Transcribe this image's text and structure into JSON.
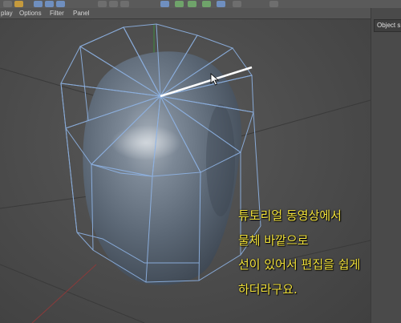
{
  "menubar": {
    "items": [
      "play",
      "Options",
      "Filter",
      "Panel"
    ]
  },
  "right_panel": {
    "tab_label": "Object s"
  },
  "subtitle": {
    "lines": [
      "튜토리얼 동영상에서",
      "물체 바깥으로",
      "선이 있어서 편집을 쉽게",
      "하더라구요."
    ]
  },
  "colors": {
    "wireframe": "#8fb4e6",
    "subtitle_text": "#f2e23a",
    "selected_edge": "#ffffff",
    "object_body": "#5d6a78"
  }
}
